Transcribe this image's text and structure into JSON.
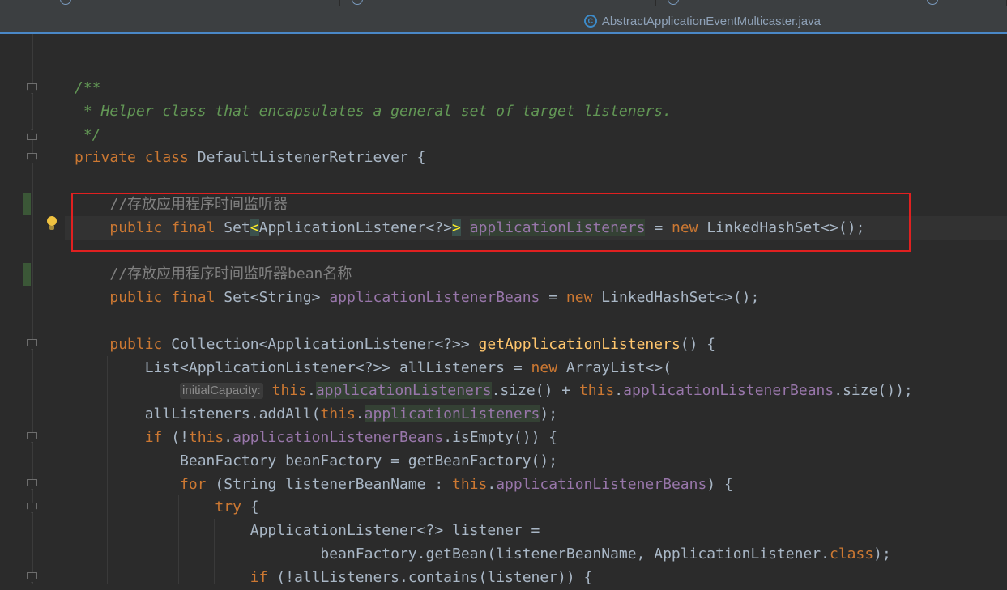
{
  "editor_tabs": {
    "active_tab_label": "AbstractApplicationEventMulticaster.java",
    "active_tab_icon": "java-class-icon"
  },
  "code": {
    "lines": [
      {
        "segments": [
          {
            "t": "/**",
            "c": "doc"
          }
        ]
      },
      {
        "segments": [
          {
            "t": " * Helper class that encapsulates a general set of target listeners.",
            "c": "doc"
          }
        ]
      },
      {
        "segments": [
          {
            "t": " */",
            "c": "doc"
          }
        ]
      },
      {
        "segments": [
          {
            "t": "private",
            "c": "kw"
          },
          {
            "t": " "
          },
          {
            "t": "class",
            "c": "kw"
          },
          {
            "t": " DefaultListenerRetriever {"
          }
        ]
      },
      {
        "segments": []
      },
      {
        "segments": [
          {
            "t": "    "
          },
          {
            "t": "//存放应用程序时间监听器",
            "c": "cm"
          }
        ]
      },
      {
        "segments": [
          {
            "t": "    "
          },
          {
            "t": "public",
            "c": "kw"
          },
          {
            "t": " "
          },
          {
            "t": "final",
            "c": "kw"
          },
          {
            "t": " Set"
          },
          {
            "t": "<",
            "c": "brm"
          },
          {
            "t": "ApplicationListener<?>"
          },
          {
            "t": ">",
            "c": "brm"
          },
          {
            "t": " "
          },
          {
            "t": "applicationListeners",
            "c": "fld hlw"
          },
          {
            "t": " = "
          },
          {
            "t": "new",
            "c": "kw"
          },
          {
            "t": " LinkedHashSet<>();"
          }
        ]
      },
      {
        "segments": []
      },
      {
        "segments": [
          {
            "t": "    "
          },
          {
            "t": "//存放应用程序时间监听器bean名称",
            "c": "cm"
          }
        ]
      },
      {
        "segments": [
          {
            "t": "    "
          },
          {
            "t": "public",
            "c": "kw"
          },
          {
            "t": " "
          },
          {
            "t": "final",
            "c": "kw"
          },
          {
            "t": " Set<String> "
          },
          {
            "t": "applicationListenerBeans",
            "c": "fld"
          },
          {
            "t": " = "
          },
          {
            "t": "new",
            "c": "kw"
          },
          {
            "t": " LinkedHashSet<>();"
          }
        ]
      },
      {
        "segments": []
      },
      {
        "segments": [
          {
            "t": "    "
          },
          {
            "t": "public",
            "c": "kw"
          },
          {
            "t": " Collection<ApplicationListener<?>> "
          },
          {
            "t": "getApplicationListeners",
            "c": "mth"
          },
          {
            "t": "() {"
          }
        ]
      },
      {
        "segments": [
          {
            "t": "        List<ApplicationListener<?>> allListeners = "
          },
          {
            "t": "new",
            "c": "kw"
          },
          {
            "t": " ArrayList<>("
          }
        ]
      },
      {
        "segments": [
          {
            "t": "            "
          },
          {
            "t": "initialCapacity:",
            "c": "hint"
          },
          {
            "t": " "
          },
          {
            "t": "this",
            "c": "kw"
          },
          {
            "t": "."
          },
          {
            "t": "applicationListeners",
            "c": "fld hlw"
          },
          {
            "t": ".size() + "
          },
          {
            "t": "this",
            "c": "kw"
          },
          {
            "t": "."
          },
          {
            "t": "applicationListenerBeans",
            "c": "fld"
          },
          {
            "t": ".size());"
          }
        ]
      },
      {
        "segments": [
          {
            "t": "        allListeners.addAll("
          },
          {
            "t": "this",
            "c": "kw"
          },
          {
            "t": "."
          },
          {
            "t": "applicationListeners",
            "c": "fld hlw"
          },
          {
            "t": ");"
          }
        ]
      },
      {
        "segments": [
          {
            "t": "        "
          },
          {
            "t": "if",
            "c": "kw"
          },
          {
            "t": " (!"
          },
          {
            "t": "this",
            "c": "kw"
          },
          {
            "t": "."
          },
          {
            "t": "applicationListenerBeans",
            "c": "fld"
          },
          {
            "t": ".isEmpty()) {"
          }
        ]
      },
      {
        "segments": [
          {
            "t": "            BeanFactory beanFactory = getBeanFactory();"
          }
        ]
      },
      {
        "segments": [
          {
            "t": "            "
          },
          {
            "t": "for",
            "c": "kw"
          },
          {
            "t": " (String listenerBeanName : "
          },
          {
            "t": "this",
            "c": "kw"
          },
          {
            "t": "."
          },
          {
            "t": "applicationListenerBeans",
            "c": "fld"
          },
          {
            "t": ") {"
          }
        ]
      },
      {
        "segments": [
          {
            "t": "                "
          },
          {
            "t": "try",
            "c": "kw"
          },
          {
            "t": " {"
          }
        ]
      },
      {
        "segments": [
          {
            "t": "                    ApplicationListener<?> listener ="
          }
        ]
      },
      {
        "segments": [
          {
            "t": "                            beanFactory.getBean(listenerBeanName, ApplicationListener."
          },
          {
            "t": "class",
            "c": "kw"
          },
          {
            "t": ");"
          }
        ]
      },
      {
        "segments": [
          {
            "t": "                    "
          },
          {
            "t": "if",
            "c": "kw"
          },
          {
            "t": " (!allListeners.contains(listener)) {"
          }
        ]
      }
    ]
  }
}
